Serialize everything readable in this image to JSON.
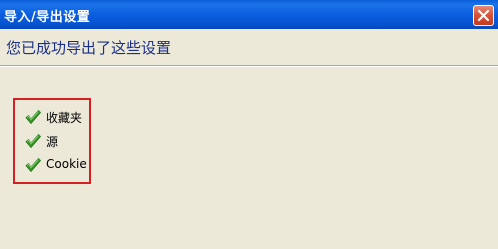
{
  "window": {
    "title": "导入/导出设置",
    "close_label": "×"
  },
  "header": {
    "heading": "您已成功导出了这些设置"
  },
  "results": {
    "items": [
      {
        "label": "收藏夹",
        "icon": "green-checkmark-icon"
      },
      {
        "label": "源",
        "icon": "green-checkmark-icon"
      },
      {
        "label": "Cookie",
        "icon": "green-checkmark-icon"
      }
    ],
    "highlight_color": "#d42020"
  },
  "colors": {
    "titlebar": "#0b5fe0",
    "dialog_background": "#ece9d8",
    "heading_text": "#1b2f8a",
    "checkmark": "#3a9a2a"
  }
}
